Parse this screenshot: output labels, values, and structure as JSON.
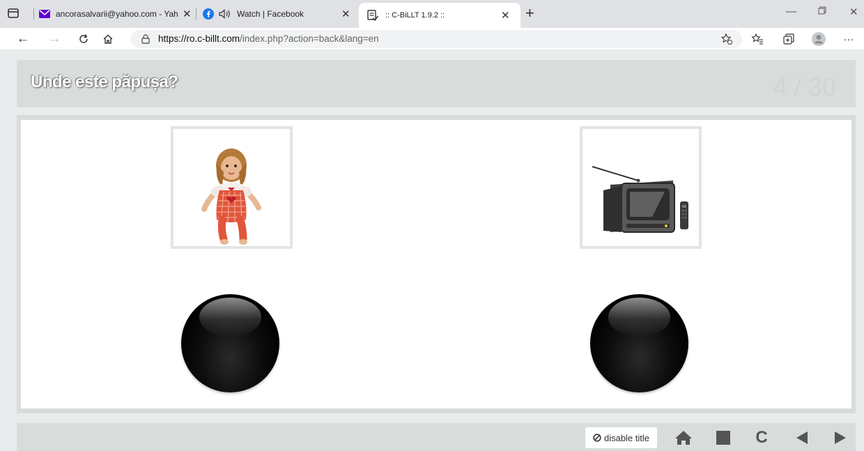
{
  "browser": {
    "tabs": [
      {
        "label": "ancorasalvarii@yahoo.com - Yah",
        "icon": "mail-icon"
      },
      {
        "label": "Watch | Facebook",
        "icon": "facebook-icon",
        "audio": true
      },
      {
        "label": ":: C-BiLLT 1.9.2 ::",
        "icon": "reader-icon",
        "active": true
      }
    ],
    "url_host": "https://ro.c-billt.com",
    "url_path": "/index.php?action=back&lang=en"
  },
  "page": {
    "question": "Unde este păpușa?",
    "counter": "4 / 30"
  },
  "footer": {
    "disable_label": "disable title",
    "c_label": "C"
  },
  "colors": {
    "panel": "#d8dddb",
    "background": "#e9ecec",
    "counter": "#cfd5d3",
    "ball": "#000000"
  }
}
